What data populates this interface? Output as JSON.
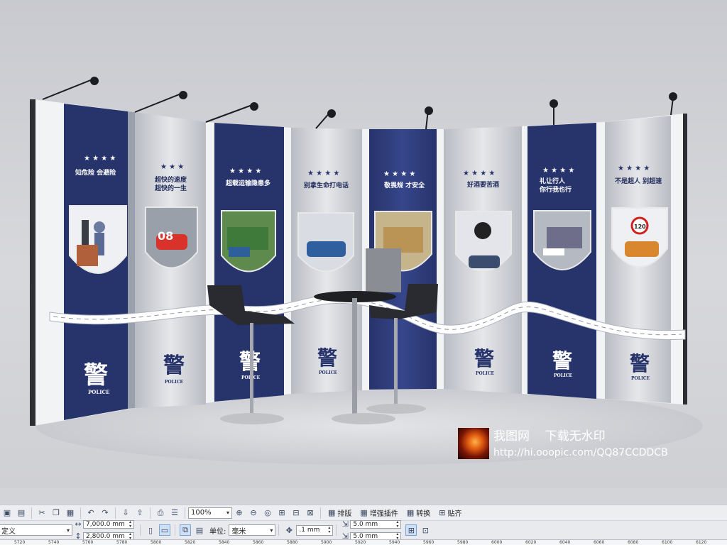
{
  "scene": {
    "panels": [
      {
        "slogan": "知危险 会避险"
      },
      {
        "slogan": "超快的速度\n超快的一生"
      },
      {
        "slogan": "超载运输隐患多"
      },
      {
        "slogan": "别拿生命打电话"
      },
      {
        "slogan": "敬畏规 才安全"
      },
      {
        "slogan": "好酒要苦酒"
      },
      {
        "slogan": "礼让行人\n你行我也行"
      },
      {
        "slogan": "不是超人 别超速"
      }
    ],
    "badge_police_text": "POLICE",
    "badge_char": "警",
    "speed_sign": "120",
    "car_plate": "08",
    "colors": {
      "navy": "#27336b",
      "silver": "#c4c6cc",
      "white": "#f4f5f7"
    }
  },
  "watermark": {
    "site": "我图网",
    "tagline": "下载无水印",
    "url": "http://hi.ooopic.com/QQ87CCDDCB"
  },
  "toolbar": {
    "zoom": "100%",
    "buttons": [
      {
        "label": "排版",
        "icon": "layout-icon"
      },
      {
        "label": "增强插件",
        "icon": "plugin-icon"
      },
      {
        "label": "转换",
        "icon": "convert-icon"
      },
      {
        "label": "贴齐",
        "icon": "snap-icon"
      }
    ]
  },
  "propbar": {
    "page_preset": "定义",
    "width": "7,000.0 mm",
    "height": "2,800.0 mm",
    "unit_label": "单位:",
    "unit_value": "毫米",
    "nudge": ".1 mm",
    "dup_x": "5.0 mm",
    "dup_y": "5.0 mm"
  },
  "ruler": {
    "ticks": [
      "5720",
      "5740",
      "5760",
      "5780",
      "5800",
      "5820",
      "5840",
      "5860",
      "5880",
      "5900",
      "5920",
      "5940",
      "5960",
      "5980",
      "6000",
      "6020",
      "6040",
      "6060",
      "6080",
      "6100",
      "6120"
    ]
  }
}
